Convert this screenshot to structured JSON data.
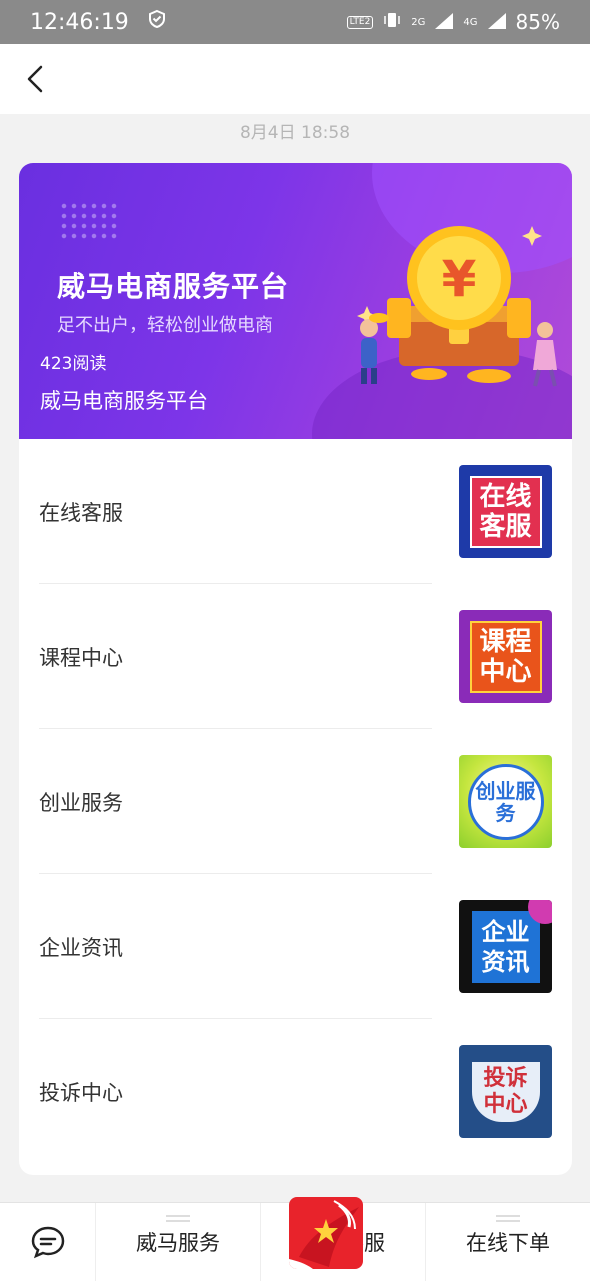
{
  "status_bar": {
    "time": "12:46:19",
    "battery": "85%",
    "volte": "LTE2",
    "net_2g": "2G",
    "net_4g": "4G",
    "icons": [
      "shield-icon",
      "volte-icon",
      "vibrate-icon",
      "signal-2g-icon",
      "signal-4g-icon"
    ]
  },
  "header": {
    "back_icon": "back-chevron-icon"
  },
  "timestamp": "8月4日 18:58",
  "banner": {
    "title": "威马电商服务平台",
    "subtitle": "足不出户，轻松创业做电商",
    "reads": "423阅读",
    "name": "威马电商服务平台",
    "art_symbol": "¥",
    "colors": {
      "start": "#6a2fe0",
      "end": "#b04bd8"
    }
  },
  "menu": [
    {
      "label": "在线客服",
      "thumb_text": "在线客服"
    },
    {
      "label": "课程中心",
      "thumb_text": "课程中心"
    },
    {
      "label": "创业服务",
      "thumb_text": "创业服务"
    },
    {
      "label": "企业资讯",
      "thumb_text": "企业资讯"
    },
    {
      "label": "投诉中心",
      "thumb_text": "投诉中心"
    }
  ],
  "bottom_bar": {
    "keyboard_icon": "chat-bubble-icon",
    "tabs": [
      "威马服务",
      "在线客服",
      "在线下单"
    ]
  },
  "accent": "#e8232b"
}
